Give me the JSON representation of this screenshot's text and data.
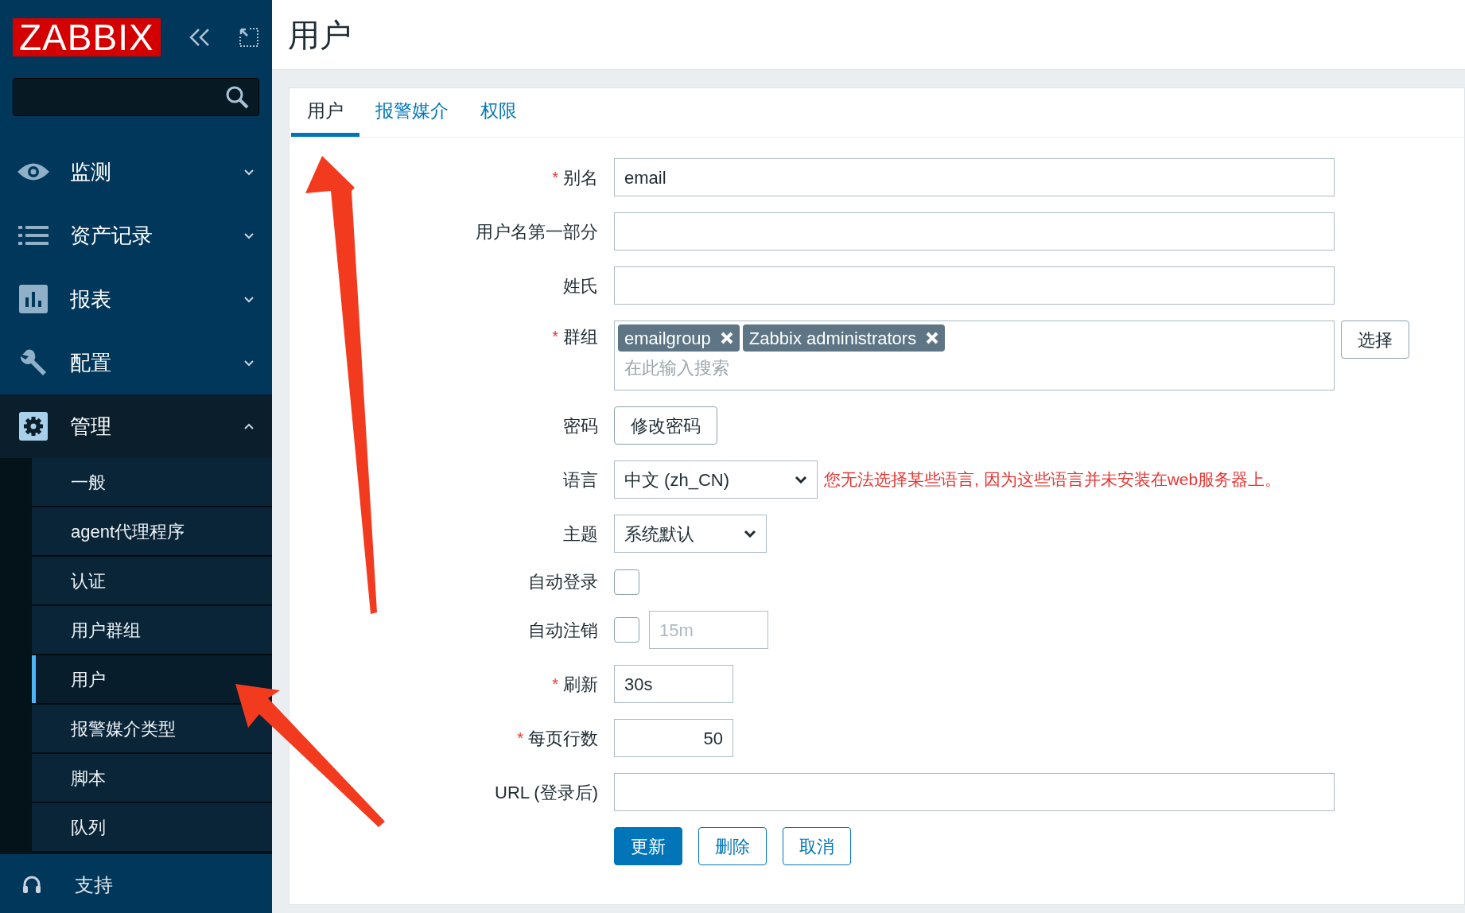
{
  "sidebar": {
    "logo": "ZABBIX",
    "menu": [
      {
        "label": "监测",
        "expanded": false
      },
      {
        "label": "资产记录",
        "expanded": false
      },
      {
        "label": "报表",
        "expanded": false
      },
      {
        "label": "配置",
        "expanded": false
      },
      {
        "label": "管理",
        "expanded": true,
        "children": [
          {
            "label": "一般",
            "selected": false
          },
          {
            "label": "agent代理程序",
            "selected": false
          },
          {
            "label": "认证",
            "selected": false
          },
          {
            "label": "用户群组",
            "selected": false
          },
          {
            "label": "用户",
            "selected": true
          },
          {
            "label": "报警媒介类型",
            "selected": false
          },
          {
            "label": "脚本",
            "selected": false
          },
          {
            "label": "队列",
            "selected": false
          }
        ]
      }
    ],
    "support": "支持"
  },
  "page_title": "用户",
  "tabs": [
    {
      "label": "用户",
      "selected": true
    },
    {
      "label": "报警媒介",
      "selected": false
    },
    {
      "label": "权限",
      "selected": false
    }
  ],
  "form": {
    "fields": [
      {
        "kind": "text",
        "label": "别名",
        "mark": "*",
        "value": "email"
      },
      {
        "kind": "text",
        "label": "用户名第一部分"
      },
      {
        "kind": "text",
        "label": "姓氏"
      },
      {
        "kind": "tags",
        "label": "群组",
        "mark": "*",
        "tags": [
          "emailgroup",
          "Zabbix administrators"
        ],
        "placeholder": "在此输入搜索",
        "button": "选择"
      },
      {
        "kind": "button",
        "label": "密码",
        "button": "修改密码"
      },
      {
        "kind": "select",
        "label": "语言",
        "value": "中文 (zh_CN)",
        "note": "您无法选择某些语言, 因为这些语言并未安装在web服务器上。"
      },
      {
        "kind": "select",
        "label": "主题",
        "value": "系统默认"
      },
      {
        "kind": "checkbox",
        "label": "自动登录",
        "checked": false
      },
      {
        "kind": "checkbox_input",
        "label": "自动注销",
        "checked": false,
        "value": "15m",
        "disabled": true
      },
      {
        "kind": "short",
        "label": "刷新",
        "mark": "*",
        "value": "30s"
      },
      {
        "kind": "number",
        "label": "每页行数",
        "mark": "*",
        "value": "50"
      },
      {
        "kind": "text",
        "label": "URL (登录后)"
      }
    ],
    "buttons": [
      {
        "label": "更新",
        "primary": true
      },
      {
        "label": "删除",
        "primary": false
      },
      {
        "label": "取消",
        "primary": false
      }
    ]
  }
}
